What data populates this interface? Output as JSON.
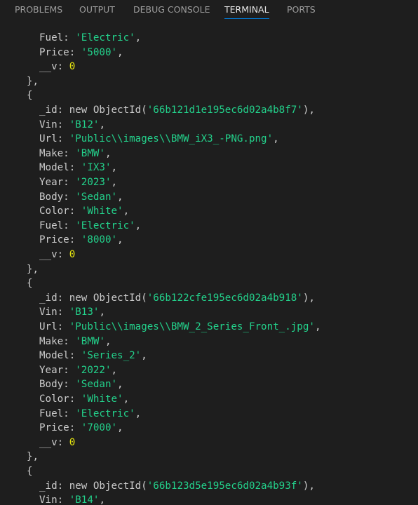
{
  "panel": {
    "tabs": [
      {
        "label": "PROBLEMS",
        "active": false
      },
      {
        "label": "OUTPUT",
        "active": false
      },
      {
        "label": "DEBUG CONSOLE",
        "active": false
      },
      {
        "label": "TERMINAL",
        "active": true
      },
      {
        "label": "PORTS",
        "active": false
      }
    ]
  },
  "colors": {
    "background": "#1e1e1e",
    "text": "#cccccc",
    "string": "#23d18b",
    "number": "#e5e510",
    "active_tab_underline": "#0078d4"
  },
  "terminal": {
    "lines": [
      {
        "indent": 2,
        "parts": [
          {
            "t": "Fuel: ",
            "c": "k"
          },
          {
            "t": "'Electric'",
            "c": "s"
          },
          {
            "t": ",",
            "c": "p"
          }
        ]
      },
      {
        "indent": 2,
        "parts": [
          {
            "t": "Price: ",
            "c": "k"
          },
          {
            "t": "'5000'",
            "c": "s"
          },
          {
            "t": ",",
            "c": "p"
          }
        ]
      },
      {
        "indent": 2,
        "parts": [
          {
            "t": "__v: ",
            "c": "k"
          },
          {
            "t": "0",
            "c": "n"
          }
        ]
      },
      {
        "indent": 1,
        "parts": [
          {
            "t": "},",
            "c": "p"
          }
        ]
      },
      {
        "indent": 1,
        "parts": [
          {
            "t": "{",
            "c": "p"
          }
        ]
      },
      {
        "indent": 2,
        "parts": [
          {
            "t": "_id: new ObjectId(",
            "c": "k"
          },
          {
            "t": "'66b121d1e195ec6d02a4b8f7'",
            "c": "s"
          },
          {
            "t": "),",
            "c": "p"
          }
        ]
      },
      {
        "indent": 2,
        "parts": [
          {
            "t": "Vin: ",
            "c": "k"
          },
          {
            "t": "'B12'",
            "c": "s"
          },
          {
            "t": ",",
            "c": "p"
          }
        ]
      },
      {
        "indent": 2,
        "parts": [
          {
            "t": "Url: ",
            "c": "k"
          },
          {
            "t": "'Public\\\\images\\\\BMW_iX3_-PNG.png'",
            "c": "s"
          },
          {
            "t": ",",
            "c": "p"
          }
        ]
      },
      {
        "indent": 2,
        "parts": [
          {
            "t": "Make: ",
            "c": "k"
          },
          {
            "t": "'BMW'",
            "c": "s"
          },
          {
            "t": ",",
            "c": "p"
          }
        ]
      },
      {
        "indent": 2,
        "parts": [
          {
            "t": "Model: ",
            "c": "k"
          },
          {
            "t": "'IX3'",
            "c": "s"
          },
          {
            "t": ",",
            "c": "p"
          }
        ]
      },
      {
        "indent": 2,
        "parts": [
          {
            "t": "Year: ",
            "c": "k"
          },
          {
            "t": "'2023'",
            "c": "s"
          },
          {
            "t": ",",
            "c": "p"
          }
        ]
      },
      {
        "indent": 2,
        "parts": [
          {
            "t": "Body: ",
            "c": "k"
          },
          {
            "t": "'Sedan'",
            "c": "s"
          },
          {
            "t": ",",
            "c": "p"
          }
        ]
      },
      {
        "indent": 2,
        "parts": [
          {
            "t": "Color: ",
            "c": "k"
          },
          {
            "t": "'White'",
            "c": "s"
          },
          {
            "t": ",",
            "c": "p"
          }
        ]
      },
      {
        "indent": 2,
        "parts": [
          {
            "t": "Fuel: ",
            "c": "k"
          },
          {
            "t": "'Electric'",
            "c": "s"
          },
          {
            "t": ",",
            "c": "p"
          }
        ]
      },
      {
        "indent": 2,
        "parts": [
          {
            "t": "Price: ",
            "c": "k"
          },
          {
            "t": "'8000'",
            "c": "s"
          },
          {
            "t": ",",
            "c": "p"
          }
        ]
      },
      {
        "indent": 2,
        "parts": [
          {
            "t": "__v: ",
            "c": "k"
          },
          {
            "t": "0",
            "c": "n"
          }
        ]
      },
      {
        "indent": 1,
        "parts": [
          {
            "t": "},",
            "c": "p"
          }
        ]
      },
      {
        "indent": 1,
        "parts": [
          {
            "t": "{",
            "c": "p"
          }
        ]
      },
      {
        "indent": 2,
        "parts": [
          {
            "t": "_id: new ObjectId(",
            "c": "k"
          },
          {
            "t": "'66b122cfe195ec6d02a4b918'",
            "c": "s"
          },
          {
            "t": "),",
            "c": "p"
          }
        ]
      },
      {
        "indent": 2,
        "parts": [
          {
            "t": "Vin: ",
            "c": "k"
          },
          {
            "t": "'B13'",
            "c": "s"
          },
          {
            "t": ",",
            "c": "p"
          }
        ]
      },
      {
        "indent": 2,
        "parts": [
          {
            "t": "Url: ",
            "c": "k"
          },
          {
            "t": "'Public\\\\images\\\\BMW_2_Series_Front_.jpg'",
            "c": "s"
          },
          {
            "t": ",",
            "c": "p"
          }
        ]
      },
      {
        "indent": 2,
        "parts": [
          {
            "t": "Make: ",
            "c": "k"
          },
          {
            "t": "'BMW'",
            "c": "s"
          },
          {
            "t": ",",
            "c": "p"
          }
        ]
      },
      {
        "indent": 2,
        "parts": [
          {
            "t": "Model: ",
            "c": "k"
          },
          {
            "t": "'Series_2'",
            "c": "s"
          },
          {
            "t": ",",
            "c": "p"
          }
        ]
      },
      {
        "indent": 2,
        "parts": [
          {
            "t": "Year: ",
            "c": "k"
          },
          {
            "t": "'2022'",
            "c": "s"
          },
          {
            "t": ",",
            "c": "p"
          }
        ]
      },
      {
        "indent": 2,
        "parts": [
          {
            "t": "Body: ",
            "c": "k"
          },
          {
            "t": "'Sedan'",
            "c": "s"
          },
          {
            "t": ",",
            "c": "p"
          }
        ]
      },
      {
        "indent": 2,
        "parts": [
          {
            "t": "Color: ",
            "c": "k"
          },
          {
            "t": "'White'",
            "c": "s"
          },
          {
            "t": ",",
            "c": "p"
          }
        ]
      },
      {
        "indent": 2,
        "parts": [
          {
            "t": "Fuel: ",
            "c": "k"
          },
          {
            "t": "'Electric'",
            "c": "s"
          },
          {
            "t": ",",
            "c": "p"
          }
        ]
      },
      {
        "indent": 2,
        "parts": [
          {
            "t": "Price: ",
            "c": "k"
          },
          {
            "t": "'7000'",
            "c": "s"
          },
          {
            "t": ",",
            "c": "p"
          }
        ]
      },
      {
        "indent": 2,
        "parts": [
          {
            "t": "__v: ",
            "c": "k"
          },
          {
            "t": "0",
            "c": "n"
          }
        ]
      },
      {
        "indent": 1,
        "parts": [
          {
            "t": "},",
            "c": "p"
          }
        ]
      },
      {
        "indent": 1,
        "parts": [
          {
            "t": "{",
            "c": "p"
          }
        ]
      },
      {
        "indent": 2,
        "parts": [
          {
            "t": "_id: new ObjectId(",
            "c": "k"
          },
          {
            "t": "'66b123d5e195ec6d02a4b93f'",
            "c": "s"
          },
          {
            "t": "),",
            "c": "p"
          }
        ]
      },
      {
        "indent": 2,
        "parts": [
          {
            "t": "Vin: ",
            "c": "k"
          },
          {
            "t": "'B14'",
            "c": "s"
          },
          {
            "t": ",",
            "c": "p"
          }
        ]
      }
    ]
  }
}
